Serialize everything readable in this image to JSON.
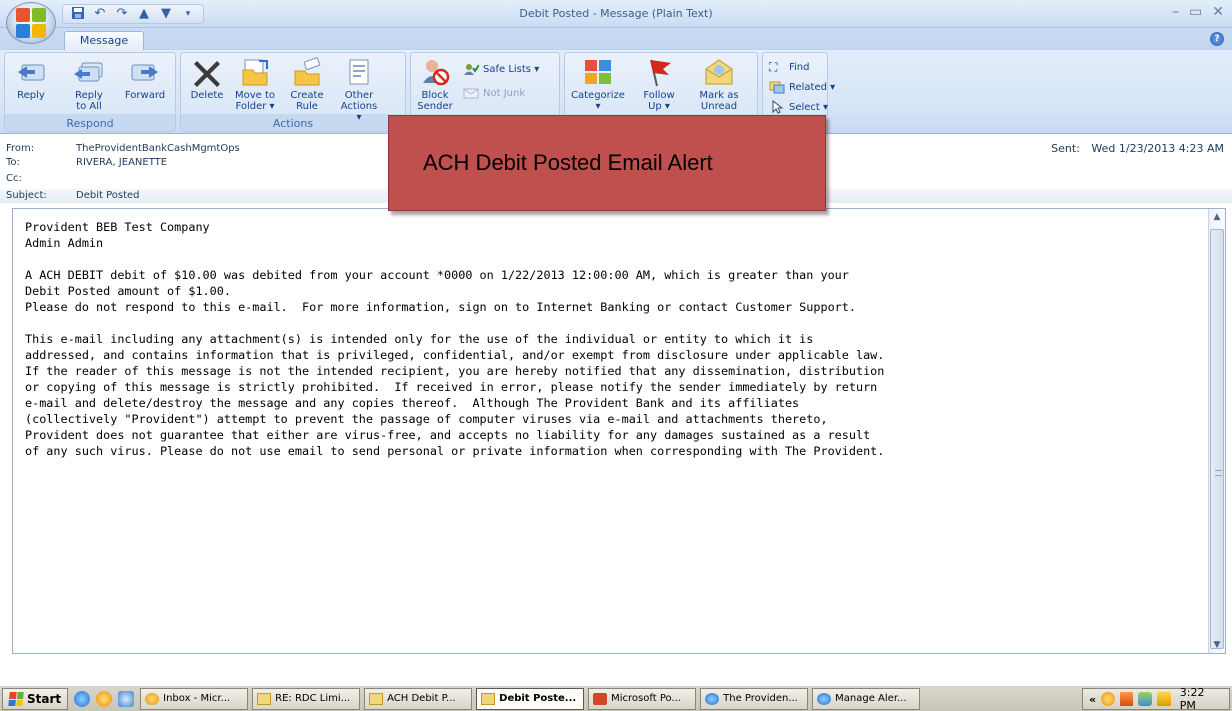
{
  "window": {
    "title": "Debit Posted - Message (Plain Text)",
    "min_glyph": "–",
    "restore_glyph": "▭",
    "close_glyph": "✕"
  },
  "ribbon": {
    "tab": "Message",
    "help": "?",
    "respond": {
      "label": "Respond",
      "reply": "Reply",
      "reply_all": "Reply\nto All",
      "forward": "Forward"
    },
    "actions": {
      "label": "Actions",
      "delete": "Delete",
      "move_to_folder": "Move to\nFolder ▾",
      "create_rule": "Create\nRule",
      "other_actions": "Other\nActions ▾"
    },
    "junk": {
      "block_sender": "Block\nSender",
      "safe_lists": "Safe Lists ▾",
      "not_junk": "Not Junk"
    },
    "options": {
      "categorize": "Categorize\n▾",
      "follow_up": "Follow\nUp ▾",
      "mark_as_unread": "Mark as\nUnread"
    },
    "find": {
      "find": "Find",
      "related": "Related ▾",
      "select": "Select ▾"
    }
  },
  "header": {
    "from_label": "From:",
    "from": "TheProvidentBankCashMgmtOps",
    "to_label": "To:",
    "to": "RIVERA, JEANETTE",
    "cc_label": "Cc:",
    "cc": "",
    "subject_label": "Subject:",
    "subject": "Debit Posted",
    "sent_label": "Sent:",
    "sent": "Wed 1/23/2013 4:23 AM"
  },
  "callout": {
    "text": "ACH Debit Posted Email Alert"
  },
  "body": {
    "line1": "Provident BEB Test Company",
    "line2": "Admin Admin",
    "line3": "A ACH DEBIT debit of $10.00 was debited from your account *0000 on 1/22/2013 12:00:00 AM, which is greater than your",
    "line4": "Debit Posted amount of $1.00.",
    "line5": "Please do not respond to this e-mail.  For more information, sign on to Internet Banking or contact Customer Support.",
    "line6": "This e-mail including any attachment(s) is intended only for the use of the individual or entity to which it is",
    "line7": "addressed, and contains information that is privileged, confidential, and/or exempt from disclosure under applicable law.",
    "line8": "If the reader of this message is not the intended recipient, you are hereby notified that any dissemination, distribution",
    "line9": "or copying of this message is strictly prohibited.  If received in error, please notify the sender immediately by return",
    "line10": "e-mail and delete/destroy the message and any copies thereof.  Although The Provident Bank and its affiliates",
    "line11": "(collectively \"Provident\") attempt to prevent the passage of computer viruses via e-mail and attachments thereto,",
    "line12": "Provident does not guarantee that either are virus-free, and accepts no liability for any damages sustained as a result",
    "line13": "of any such virus. Please do not use email to send personal or private information when corresponding with The Provident."
  },
  "taskbar": {
    "start": "Start",
    "tasks": [
      {
        "label": "Inbox - Micr...",
        "icon": "outlook-icon"
      },
      {
        "label": "RE: RDC Limi...",
        "icon": "mail-icon"
      },
      {
        "label": "ACH Debit P...",
        "icon": "mail-icon"
      },
      {
        "label": "Debit Poste...",
        "icon": "mail-icon",
        "active": true
      },
      {
        "label": "Microsoft Po...",
        "icon": "powerpoint-icon"
      },
      {
        "label": "The Providen...",
        "icon": "ie-icon"
      },
      {
        "label": "Manage Aler...",
        "icon": "ie-icon"
      }
    ],
    "tray_chevron": "«",
    "clock": "3:22 PM"
  },
  "colors": {
    "ribbon_text": "#15428b",
    "callout_fill": "#c0504d",
    "taskbar": "#d4d0c8"
  }
}
